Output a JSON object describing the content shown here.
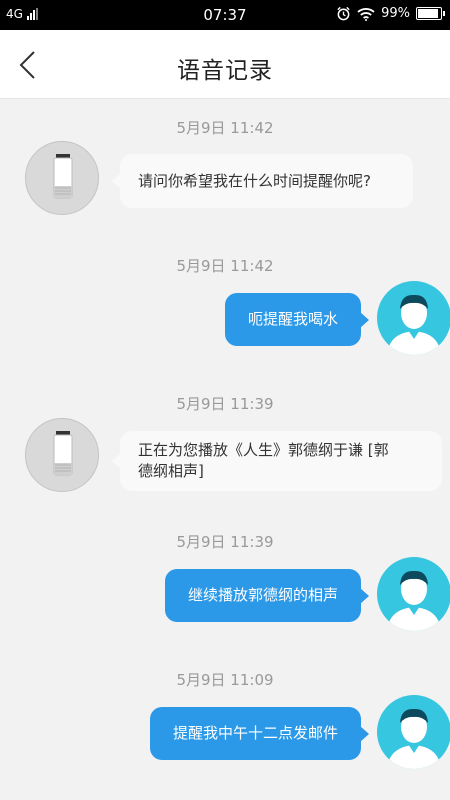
{
  "status_bar": {
    "network": "4G",
    "time": "07:37",
    "battery": "99%",
    "battery_level": 0.99,
    "icons": [
      "signal-icon",
      "alarm-icon",
      "wifi-icon",
      "battery-icon"
    ]
  },
  "header": {
    "title": "语音记录",
    "back_icon": "chevron-left-icon"
  },
  "colors": {
    "user_bubble": "#2b98e8",
    "user_avatar": "#36c6e0",
    "device_bubble": "#f9f9f9",
    "background": "#f2f2f2",
    "timestamp": "#999999"
  },
  "messages": [
    {
      "time": "5月9日 11:42",
      "sender": "device",
      "text": "请问你希望我在什么时间提醒你呢?"
    },
    {
      "time": "5月9日 11:42",
      "sender": "user",
      "text": "呃提醒我喝水"
    },
    {
      "time": "5月9日 11:39",
      "sender": "device",
      "text_line1": "正在为您播放《人生》郭德纲于谦 [郭",
      "text_line2": "德纲相声]"
    },
    {
      "time": "5月9日 11:39",
      "sender": "user",
      "text": "继续播放郭德纲的相声"
    },
    {
      "time": "5月9日 11:09",
      "sender": "user",
      "text": "提醒我中午十二点发邮件"
    }
  ]
}
